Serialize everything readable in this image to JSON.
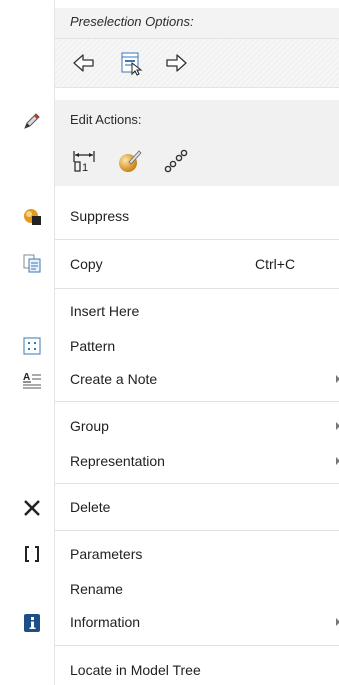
{
  "preselection": {
    "title": "Preselection Options:",
    "tools": [
      "previous-arrow-icon",
      "pick-from-list-icon",
      "next-arrow-icon"
    ]
  },
  "edit_actions": {
    "title": "Edit Actions:",
    "tools": [
      "edit-dimensions-icon",
      "edit-definition-icon",
      "edit-references-icon"
    ]
  },
  "menu": {
    "suppress": "Suppress",
    "copy": "Copy",
    "copy_shortcut": "Ctrl+C",
    "insert_here": "Insert Here",
    "pattern": "Pattern",
    "create_note": "Create a Note",
    "group": "Group",
    "representation": "Representation",
    "delete": "Delete",
    "parameters": "Parameters",
    "rename": "Rename",
    "information": "Information",
    "locate_model_tree": "Locate in Model Tree"
  },
  "colors": {
    "accent_blue": "#1f5f9c",
    "info_badge": "#1d4f86",
    "pencil": "#c0392b",
    "suppress_orange": "#e39a1c"
  }
}
